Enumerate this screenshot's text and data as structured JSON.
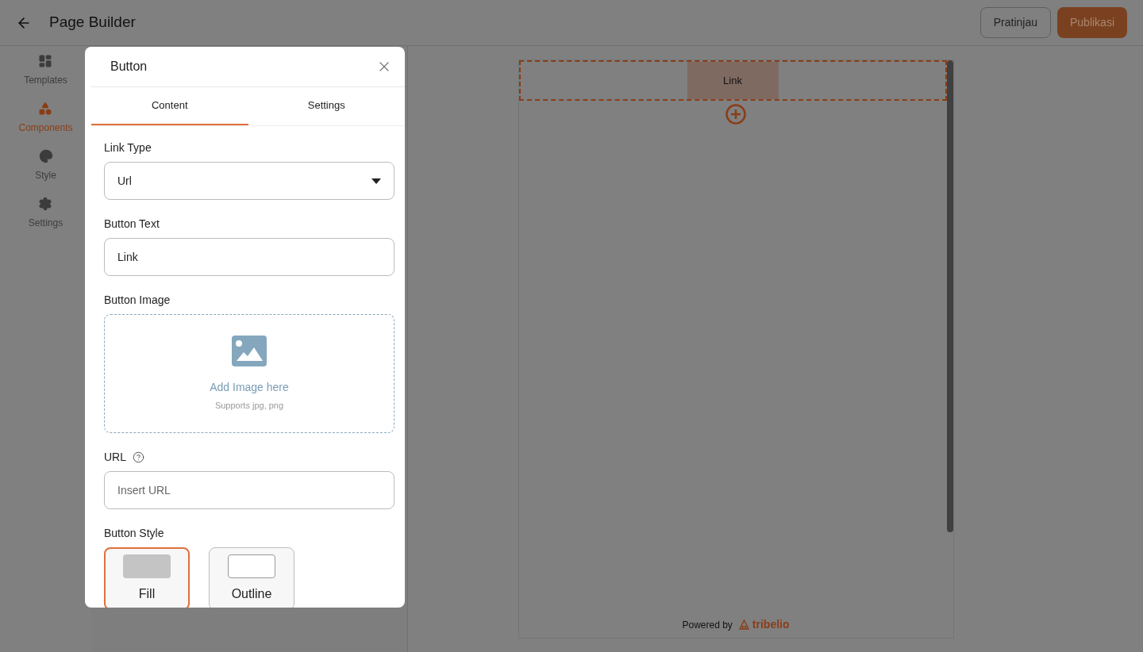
{
  "header": {
    "title": "Page Builder",
    "actions": [
      {
        "label": "Pratinjau",
        "kind": "secondary"
      },
      {
        "label": "Publikasi",
        "kind": "primary"
      }
    ]
  },
  "sidebar": {
    "items": [
      {
        "label": "Templates",
        "selected": false
      },
      {
        "label": "Components",
        "selected": true
      },
      {
        "label": "Style",
        "selected": false
      },
      {
        "label": "Settings",
        "selected": false
      }
    ]
  },
  "modal": {
    "title": "Button",
    "tabs": [
      {
        "label": "Content",
        "selected": true
      },
      {
        "label": "Settings",
        "selected": false
      }
    ],
    "fields": [
      {
        "kind": "select",
        "label": "Link Type",
        "value": "Url"
      },
      {
        "kind": "text",
        "label": "Button Text",
        "value": "Link"
      },
      {
        "kind": "upload",
        "label": "Button Image",
        "title": "Add Image here",
        "hint": "Supports jpg, png"
      },
      {
        "kind": "url",
        "label": "URL",
        "placeholder": "Insert URL"
      },
      {
        "kind": "styles",
        "label": "Button Style",
        "options": [
          {
            "label": "Fill",
            "kind": "fill",
            "selected": true
          },
          {
            "label": "Outline",
            "kind": "outline",
            "selected": false
          }
        ]
      }
    ]
  },
  "canvas": {
    "button_text": "Link",
    "footer": {
      "text": "Powered by",
      "brand": "tribelio"
    }
  }
}
